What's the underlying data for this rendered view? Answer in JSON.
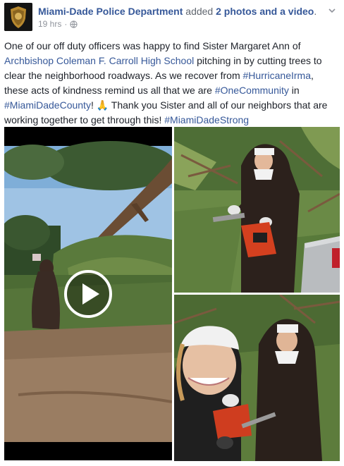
{
  "post": {
    "page_name": "Miami-Dade Police Department",
    "action_text": "added",
    "action_link": "2 photos and a video",
    "action_end": ".",
    "timestamp": "19 hrs",
    "separator": "·",
    "audience_icon": "globe-icon",
    "body": {
      "t1": "One of our off duty officers was happy to find Sister Margaret Ann of ",
      "l1": "Archbishop Coleman F. Carroll High School",
      "t2": " pitching in by cutting trees to clear the neighborhood roadways. As we recover from ",
      "l2": "#HurricaneIrma",
      "t3": ", these acts of kindness remind us all that we are ",
      "l3": "#OneCommunity",
      "t4": " in ",
      "l4": "#MiamiDadeCounty",
      "t5": "! ",
      "emoji": "🙏",
      "t6": " Thank you Sister and all of our neighbors that are working together to get through this! ",
      "l5": "#MiamiDadeStrong"
    }
  },
  "media": {
    "video_play_icon": "play-icon",
    "photo_count": 2
  },
  "colors": {
    "link": "#365899",
    "text": "#1d2129",
    "meta": "#90949c"
  }
}
